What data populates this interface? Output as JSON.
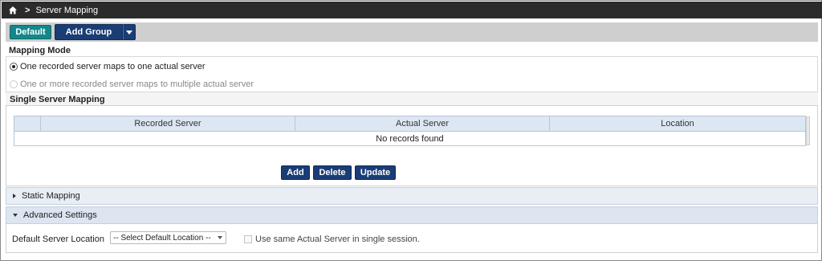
{
  "header": {
    "home_icon": "home-icon",
    "separator_icon": "chevron-right-icon",
    "title": "Server Mapping"
  },
  "toolbar": {
    "default_label": "Default",
    "add_group_label": "Add Group",
    "add_group_menu_icon": "caret-down-icon"
  },
  "mapping_mode": {
    "label": "Mapping Mode",
    "options": [
      {
        "label": "One recorded server maps to one actual server",
        "selected": true,
        "enabled": true
      },
      {
        "label": "One or more recorded server maps to multiple actual server",
        "selected": false,
        "enabled": false
      }
    ]
  },
  "single_mapping": {
    "label": "Single Server Mapping",
    "columns": [
      "",
      "Recorded Server",
      "Actual Server",
      "Location"
    ],
    "empty_text": "No records found",
    "buttons": {
      "add": "Add",
      "delete": "Delete",
      "update": "Update"
    }
  },
  "static_mapping": {
    "label": "Static Mapping",
    "expanded": false
  },
  "advanced_settings": {
    "label": "Advanced Settings",
    "expanded": true,
    "default_location_label": "Default Server Location",
    "default_location_value": "-- Select Default Location --",
    "same_server_label": "Use same Actual Server in single session.",
    "same_server_checked": false
  },
  "colors": {
    "topbar": "#2b2b2b",
    "default_button": "#13878a",
    "navy_button": "#1a3d75",
    "grid_header": "#dde6f3"
  }
}
